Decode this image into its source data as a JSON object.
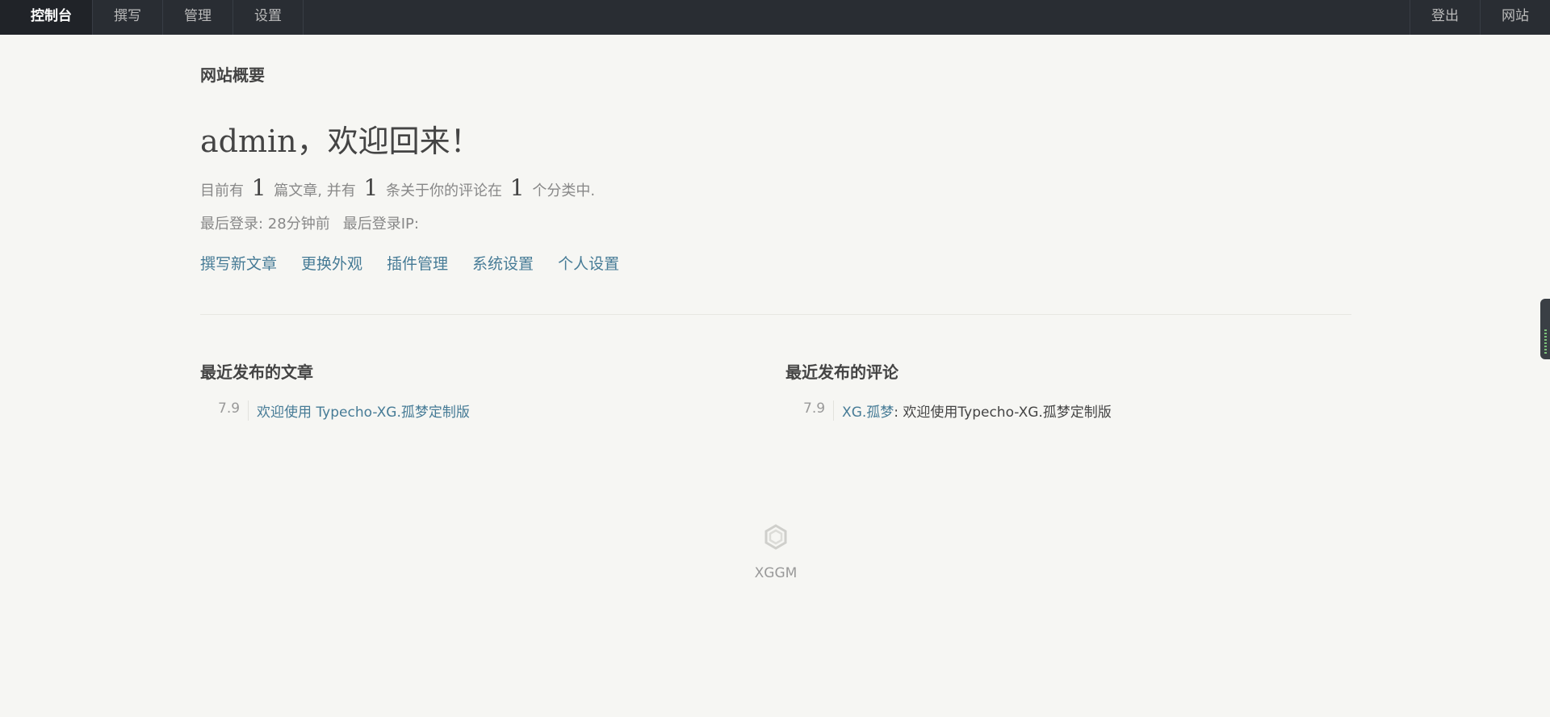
{
  "topnav": {
    "left": [
      {
        "label": "控制台",
        "active": true
      },
      {
        "label": "撰写"
      },
      {
        "label": "管理"
      },
      {
        "label": "设置"
      }
    ],
    "right": [
      {
        "label": "登出"
      },
      {
        "label": "网站"
      }
    ]
  },
  "overview": {
    "title": "网站概要",
    "welcome": "admin，欢迎回来！",
    "stats": {
      "prefix": "目前有",
      "posts_count": "1",
      "posts_text": "篇文章, 并有",
      "comments_count": "1",
      "comments_text": "条关于你的评论在",
      "categories_count": "1",
      "categories_text": "个分类中."
    },
    "last_login": "最后登录: 28分钟前",
    "last_login_ip": "最后登录IP:"
  },
  "quick_links": [
    "撰写新文章",
    "更换外观",
    "插件管理",
    "系统设置",
    "个人设置"
  ],
  "recent_posts": {
    "title": "最近发布的文章",
    "items": [
      {
        "date": "7.9",
        "title": "欢迎使用 Typecho-XG.孤梦定制版"
      }
    ]
  },
  "recent_comments": {
    "title": "最近发布的评论",
    "items": [
      {
        "date": "7.9",
        "author": "XG.孤梦",
        "text": ": 欢迎使用Typecho-XG.孤梦定制版"
      }
    ]
  },
  "footer": {
    "brand": "XGGM",
    "logo_icon": "hexagon-logo-icon"
  },
  "colors": {
    "topbar": "#292d33",
    "link": "#467b96",
    "background": "#f6f6f3"
  }
}
